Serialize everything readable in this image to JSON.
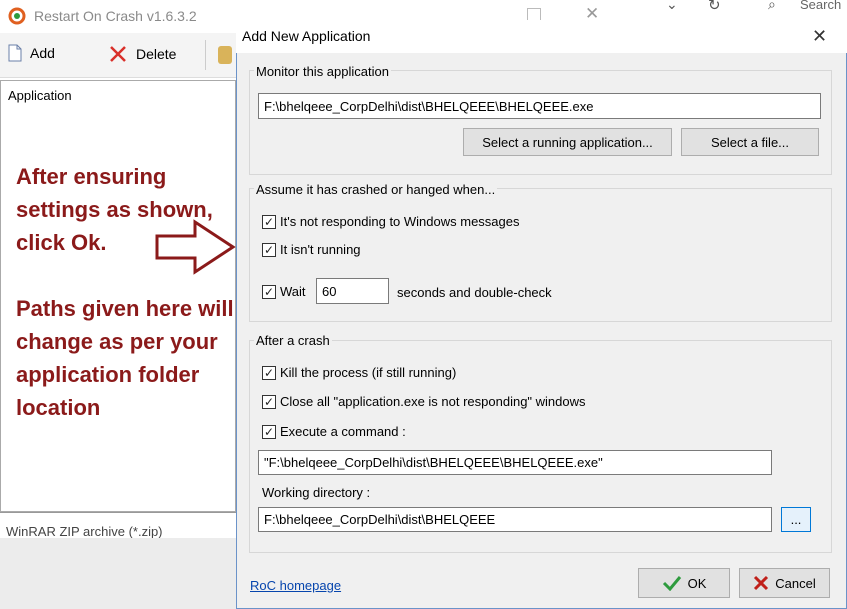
{
  "background_app": {
    "title": "Restart On Crash v1.6.3.2",
    "toolbar": {
      "add_label": "Add",
      "delete_label": "Delete"
    },
    "list_header": "Application",
    "status_text": "WinRAR ZIP archive (*.zip)"
  },
  "other_window": {
    "search_placeholder": "Search"
  },
  "annotation": {
    "text1": "After ensuring settings as shown, click Ok.",
    "text2": "Paths given here will change as per your application folder location"
  },
  "dialog": {
    "title": "Add New Application",
    "monitor": {
      "group_title": "Monitor this application",
      "path": "F:\\bhelqeee_CorpDelhi\\dist\\BHELQEEE\\BHELQEEE.exe",
      "select_running_label": "Select a running application...",
      "select_file_label": "Select a file..."
    },
    "assume": {
      "group_title": "Assume it has crashed or hanged when...",
      "not_responding_label": "It's not responding to Windows messages",
      "not_responding_checked": true,
      "not_running_label": "It isn't running",
      "not_running_checked": true,
      "wait_label": "Wait",
      "wait_checked": true,
      "wait_seconds": "60",
      "wait_suffix": "seconds and double-check"
    },
    "after_crash": {
      "group_title": "After a crash",
      "kill_label": "Kill the process (if still running)",
      "kill_checked": true,
      "close_label": "Close all \"application.exe is not responding\" windows",
      "close_checked": true,
      "execute_label": "Execute a command :",
      "execute_checked": true,
      "command": "\"F:\\bhelqeee_CorpDelhi\\dist\\BHELQEEE\\BHELQEEE.exe\"",
      "working_dir_label": "Working directory :",
      "working_dir": "F:\\bhelqeee_CorpDelhi\\dist\\BHELQEEE",
      "browse_label": "..."
    },
    "homepage_link": "RoC homepage",
    "ok_label": "OK",
    "cancel_label": "Cancel"
  },
  "colors": {
    "annotation": "#8b1a1a",
    "link": "#0645ad",
    "accent": "#0078d7"
  },
  "icons": [
    "app-icon",
    "document-icon",
    "delete-x-icon",
    "checkmark-icon",
    "cancel-x-icon",
    "search-icon",
    "refresh-icon",
    "chevron-down-icon",
    "close-icon",
    "maximize-icon"
  ]
}
